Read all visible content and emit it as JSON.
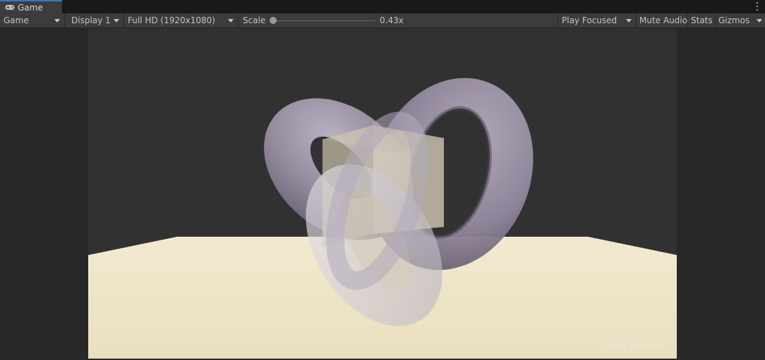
{
  "window": {
    "tab_title": "Game",
    "tab_icon": "gamepad-icon",
    "menu_icon": "more-options-icon"
  },
  "toolbar": {
    "game_view_select": "Game",
    "display_select": "Display 1",
    "resolution_select": "Full HD (1920x1080)",
    "scale_label": "Scale",
    "scale_value": "0.43x",
    "play_mode_select": "Play Focused",
    "mute_audio_label": "Mute Audio",
    "stats_label": "Stats",
    "gizmos_label": "Gizmos"
  },
  "scene": {
    "sky_color": "#313131",
    "floor_color": "#efe6cc",
    "torus_color": "#a89db2",
    "cube_color": "#d8d0b4"
  },
  "watermark": "CSDN @zczplus"
}
